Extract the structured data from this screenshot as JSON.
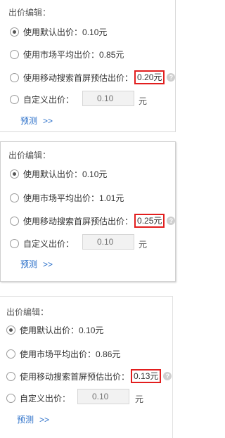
{
  "panels": [
    {
      "title": "出价编辑：",
      "options": [
        {
          "label": "使用默认出价：",
          "value": "0.10元",
          "checked": true,
          "highlight": false
        },
        {
          "label": "使用市场平均出价：",
          "value": "0.85元",
          "checked": false,
          "highlight": false
        },
        {
          "label": "使用移动搜索首屏预估出价：",
          "value": "0.20元",
          "checked": false,
          "highlight": true
        }
      ],
      "custom": {
        "label": "自定义出价：",
        "placeholder": "0.10",
        "unit": "元"
      },
      "preview": {
        "label": "预测",
        "arrows": ">>"
      }
    },
    {
      "title": "出价编辑：",
      "options": [
        {
          "label": "使用默认出价：",
          "value": "0.10元",
          "checked": true,
          "highlight": false
        },
        {
          "label": "使用市场平均出价：",
          "value": "1.01元",
          "checked": false,
          "highlight": false
        },
        {
          "label": "使用移动搜索首屏预估出价：",
          "value": "0.25元",
          "checked": false,
          "highlight": true
        }
      ],
      "custom": {
        "label": "自定义出价：",
        "placeholder": "0.10",
        "unit": "元"
      },
      "preview": {
        "label": "预测",
        "arrows": ">>"
      }
    },
    {
      "title": "出价编辑：",
      "options": [
        {
          "label": "使用默认出价：",
          "value": "0.10元",
          "checked": true,
          "highlight": false
        },
        {
          "label": "使用市场平均出价：",
          "value": "0.86元",
          "checked": false,
          "highlight": false
        },
        {
          "label": "使用移动搜索首屏预估出价：",
          "value": "0.13元",
          "checked": false,
          "highlight": true
        }
      ],
      "custom": {
        "label": "自定义出价：",
        "placeholder": "0.10",
        "unit": "元"
      },
      "preview": {
        "label": "预测",
        "arrows": ">>"
      }
    }
  ],
  "icons": {
    "help": "help-icon"
  },
  "colors": {
    "highlight_border": "#e21e1e",
    "link": "#2a6fc9"
  }
}
